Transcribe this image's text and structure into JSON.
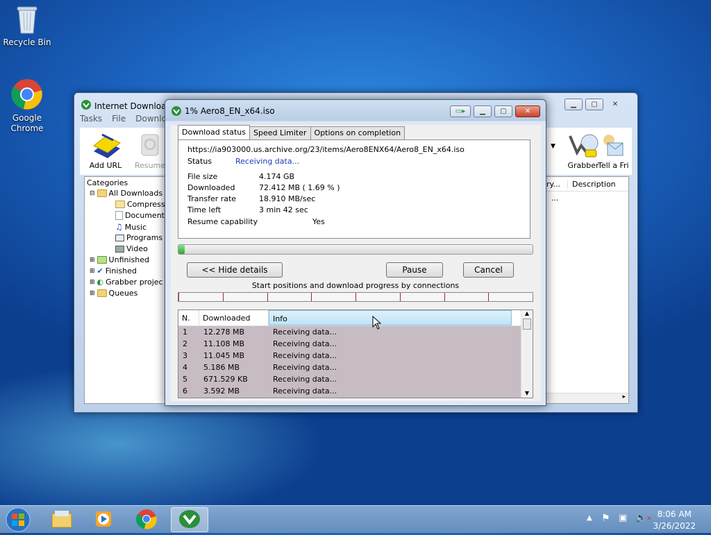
{
  "desktop": {
    "icons": [
      {
        "label": "Recycle Bin"
      },
      {
        "label": "Google Chrome"
      }
    ]
  },
  "main_window": {
    "title": "Internet Download",
    "menu": [
      "Tasks",
      "File",
      "Downlo"
    ],
    "toolbar": {
      "add_url": "Add URL",
      "resume": "Resume",
      "grabber": "Grabber",
      "tell_friend": "Tell a Fri"
    },
    "categories": {
      "header": "Categories",
      "items": [
        "All Downloads",
        "Compresse",
        "Documents",
        "Music",
        "Programs",
        "Video",
        "Unfinished",
        "Finished",
        "Grabber projec",
        "Queues"
      ]
    },
    "list_headers": {
      "col_partial": "ry...",
      "description": "Description"
    },
    "list_partial_cell": "..."
  },
  "dialog": {
    "title": "1% Aero8_EN_x64.iso",
    "tabs": [
      "Download status",
      "Speed Limiter",
      "Options on completion"
    ],
    "url": "https://ia903000.us.archive.org/23/items/Aero8ENX64/Aero8_EN_x64.iso",
    "status_label": "Status",
    "status_value": "Receiving data...",
    "file_size_label": "File size",
    "file_size_value": "4.174  GB",
    "downloaded_label": "Downloaded",
    "downloaded_value": "72.412  MB  ( 1.69 % )",
    "transfer_rate_label": "Transfer rate",
    "transfer_rate_value": "18.910  MB/sec",
    "time_left_label": "Time left",
    "time_left_value": "3 min 42 sec",
    "resume_label": "Resume capability",
    "resume_value": "Yes",
    "progress_fraction": 0.0169,
    "buttons": {
      "hide_details": "<< Hide details",
      "pause": "Pause",
      "cancel": "Cancel"
    },
    "connections_label": "Start positions and download progress by connections",
    "table": {
      "headers": [
        "N.",
        "Downloaded",
        "Info"
      ],
      "rows": [
        [
          "1",
          "12.278  MB",
          "Receiving data..."
        ],
        [
          "2",
          "11.108  MB",
          "Receiving data..."
        ],
        [
          "3",
          "11.045  MB",
          "Receiving data..."
        ],
        [
          "4",
          "5.186  MB",
          "Receiving data..."
        ],
        [
          "5",
          "671.529  KB",
          "Receiving data..."
        ],
        [
          "6",
          "3.592  MB",
          "Receiving data..."
        ]
      ]
    }
  },
  "taskbar": {
    "time": "8:06 AM",
    "date": "3/26/2022"
  },
  "colors": {
    "accent": "#1b63bf",
    "progress": "#2ea82e",
    "status_blue": "#1a3cb0"
  }
}
